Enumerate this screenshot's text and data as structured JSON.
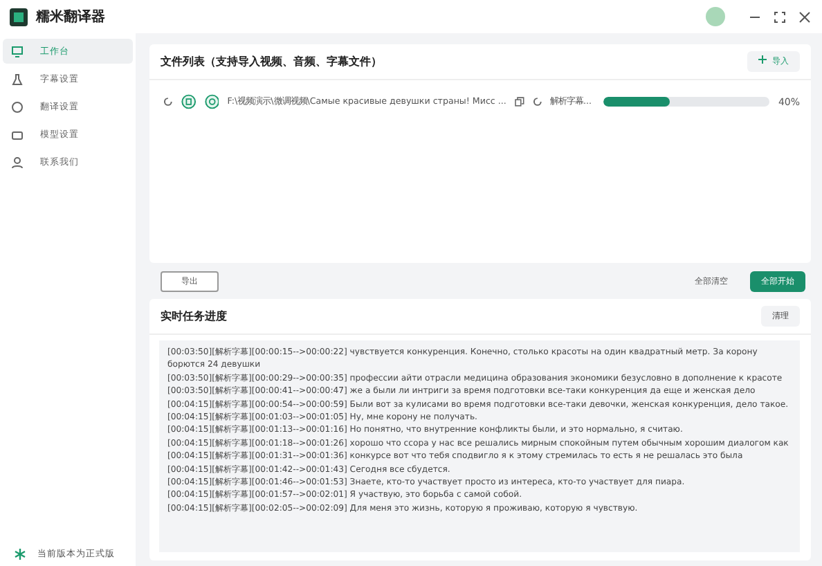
{
  "window": {
    "title": "糯米翻译器"
  },
  "sidebar": {
    "items": [
      {
        "label": "工作台",
        "selected": true,
        "kind": "monitor"
      },
      {
        "label": "字幕设置",
        "selected": false,
        "kind": "flask"
      },
      {
        "label": "翻译设置",
        "selected": false,
        "kind": "circle"
      },
      {
        "label": "模型设置",
        "selected": false,
        "kind": "box"
      },
      {
        "label": "联系我们",
        "selected": false,
        "kind": "person"
      }
    ],
    "footer": "当前版本为正式版"
  },
  "file_list": {
    "title": "文件列表（支持导入视频、音频、字幕文件）",
    "import_button": "导入",
    "files": [
      {
        "path": "F:\\视频演示\\微调视频\\Самые красивые девушки страны! Мисс ...",
        "status": "解析字幕...",
        "level": 0.4,
        "percent": "40%"
      }
    ]
  },
  "actions": {
    "export_button": "导出",
    "clear_button": "全部清空",
    "start_button": "全部开始"
  },
  "progress": {
    "title": "实时任务进度",
    "clear_button": "清理",
    "log": [
      "[00:03:50][解析字幕][00:00:15-->00:00:22] чувствуется конкуренция. Конечно, столько красоты на один квадратный метр. За корону борются 24 девушки",
      "[00:03:50][解析字幕][00:00:29-->00:00:35] профессии айти отрасли медицина образования экономики безусловно в дополнение к красоте",
      "[00:03:50][解析字幕][00:00:41-->00:00:47] же а были ли интриги за время подготовки все-таки конкуренция да еще и женская дело",
      "[00:04:15][解析字幕][00:00:54-->00:00:59] Были вот за кулисами во время подготовки все-таки девочки, женская конкуренция, дело такое.",
      "[00:04:15][解析字幕][00:01:03-->00:01:05] Ну, мне корону не получать.",
      "[00:04:15][解析字幕][00:01:13-->00:01:16] Но понятно, что внутренние конфликты были, и это нормально, я считаю.",
      "[00:04:15][解析字幕][00:01:18-->00:01:26] хорошо что ссора у нас все решались мирным спокойным путем обычным хорошим диалогом как",
      "[00:04:15][解析字幕][00:01:31-->00:01:36] конкурсе вот что тебя сподвигло я к этому стремилась то есть я не решалась это была",
      "[00:04:15][解析字幕][00:01:42-->00:01:43] Сегодня все сбудется.",
      "[00:04:15][解析字幕][00:01:46-->00:01:53] Знаете, кто-то участвует просто из интереса, кто-то участвует для пиара.",
      "[00:04:15][解析字幕][00:01:57-->00:02:01] Я участвую, это борьба с самой собой.",
      "[00:04:15][解析字幕][00:02:05-->00:02:09] Для меня это жизнь, которую я проживаю, которую я чувствую."
    ]
  }
}
